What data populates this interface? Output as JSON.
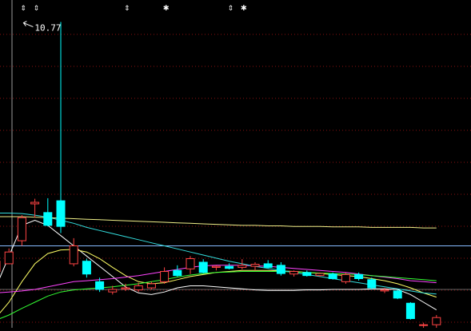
{
  "chart_data": {
    "type": "candlestick",
    "title": "",
    "xlabel": "",
    "ylabel": "",
    "ylim": [
      4.8,
      11.2
    ],
    "grid": true,
    "annotations": [
      {
        "text": "10.77",
        "at_candle": 2,
        "value": 10.77
      }
    ],
    "event_markers": [
      {
        "symbol": "⇕",
        "candle": 2
      },
      {
        "symbol": "⇕",
        "candle": 3
      },
      {
        "symbol": "⇕",
        "candle": 10
      },
      {
        "symbol": "✱",
        "candle": 13
      },
      {
        "symbol": "⇕",
        "candle": 18
      },
      {
        "symbol": "✱",
        "candle": 19
      }
    ],
    "candles": [
      {
        "o": 5.9,
        "h": 6.15,
        "l": 5.8,
        "c": 6.1,
        "dir": "up"
      },
      {
        "o": 6.28,
        "h": 6.35,
        "l": 6.05,
        "c": 6.05,
        "dir": "up"
      },
      {
        "o": 6.5,
        "h": 7.0,
        "l": 6.4,
        "c": 6.95,
        "dir": "up"
      },
      {
        "o": 7.22,
        "h": 7.32,
        "l": 6.95,
        "c": 7.25,
        "dir": "up"
      },
      {
        "o": 7.05,
        "h": 7.33,
        "l": 6.78,
        "c": 6.8,
        "dir": "down"
      },
      {
        "o": 7.28,
        "h": 10.77,
        "l": 6.65,
        "c": 6.78,
        "dir": "down"
      },
      {
        "o": 6.4,
        "h": 6.55,
        "l": 6.0,
        "c": 6.05,
        "dir": "up"
      },
      {
        "o": 6.1,
        "h": 6.15,
        "l": 5.78,
        "c": 5.85,
        "dir": "down"
      },
      {
        "o": 5.7,
        "h": 5.78,
        "l": 5.5,
        "c": 5.55,
        "dir": "down"
      },
      {
        "o": 5.55,
        "h": 5.62,
        "l": 5.45,
        "c": 5.5,
        "dir": "up"
      },
      {
        "o": 5.56,
        "h": 5.66,
        "l": 5.52,
        "c": 5.58,
        "dir": "up"
      },
      {
        "o": 5.54,
        "h": 5.68,
        "l": 5.5,
        "c": 5.62,
        "dir": "up"
      },
      {
        "o": 5.58,
        "h": 5.7,
        "l": 5.55,
        "c": 5.66,
        "dir": "up"
      },
      {
        "o": 5.7,
        "h": 5.98,
        "l": 5.66,
        "c": 5.9,
        "dir": "up"
      },
      {
        "o": 5.92,
        "h": 6.02,
        "l": 5.8,
        "c": 5.82,
        "dir": "down"
      },
      {
        "o": 5.95,
        "h": 6.2,
        "l": 5.85,
        "c": 6.15,
        "dir": "up"
      },
      {
        "o": 6.08,
        "h": 6.14,
        "l": 5.86,
        "c": 5.88,
        "dir": "down"
      },
      {
        "o": 5.98,
        "h": 6.02,
        "l": 5.92,
        "c": 6.0,
        "dir": "up"
      },
      {
        "o": 6.0,
        "h": 6.06,
        "l": 5.94,
        "c": 5.96,
        "dir": "down"
      },
      {
        "o": 5.98,
        "h": 6.14,
        "l": 5.94,
        "c": 6.02,
        "dir": "up"
      },
      {
        "o": 6.0,
        "h": 6.08,
        "l": 5.92,
        "c": 6.04,
        "dir": "up"
      },
      {
        "o": 6.05,
        "h": 6.12,
        "l": 5.96,
        "c": 5.98,
        "dir": "down"
      },
      {
        "o": 6.02,
        "h": 6.08,
        "l": 5.82,
        "c": 5.86,
        "dir": "down"
      },
      {
        "o": 5.85,
        "h": 5.92,
        "l": 5.8,
        "c": 5.9,
        "dir": "up"
      },
      {
        "o": 5.88,
        "h": 5.92,
        "l": 5.8,
        "c": 5.82,
        "dir": "down"
      },
      {
        "o": 5.82,
        "h": 5.88,
        "l": 5.8,
        "c": 5.86,
        "dir": "up"
      },
      {
        "o": 5.85,
        "h": 5.88,
        "l": 5.74,
        "c": 5.76,
        "dir": "down"
      },
      {
        "o": 5.7,
        "h": 5.88,
        "l": 5.66,
        "c": 5.84,
        "dir": "up"
      },
      {
        "o": 5.84,
        "h": 5.88,
        "l": 5.72,
        "c": 5.76,
        "dir": "down"
      },
      {
        "o": 5.74,
        "h": 5.78,
        "l": 5.55,
        "c": 5.58,
        "dir": "down"
      },
      {
        "o": 5.54,
        "h": 5.58,
        "l": 5.48,
        "c": 5.52,
        "dir": "up"
      },
      {
        "o": 5.52,
        "h": 5.54,
        "l": 5.36,
        "c": 5.38,
        "dir": "down"
      },
      {
        "o": 5.28,
        "h": 5.3,
        "l": 4.96,
        "c": 4.98,
        "dir": "down"
      },
      {
        "o": 4.86,
        "h": 4.9,
        "l": 4.8,
        "c": 4.86,
        "dir": "up"
      },
      {
        "o": 4.86,
        "h": 5.05,
        "l": 4.8,
        "c": 5.0,
        "dir": "up"
      }
    ],
    "series": [
      {
        "label_visible": false,
        "color": "#ffffff",
        "values": [
          5.6,
          6.2,
          6.8,
          6.9,
          6.8,
          6.6,
          6.4,
          6.2,
          6.0,
          5.8,
          5.6,
          5.48,
          5.45,
          5.5,
          5.58,
          5.62,
          5.62,
          5.6,
          5.58,
          5.56,
          5.54,
          5.53,
          5.53,
          5.53,
          5.54,
          5.54,
          5.55,
          5.55,
          5.55,
          5.56,
          5.56,
          5.55,
          5.45,
          5.3,
          5.15
        ]
      },
      {
        "label_visible": false,
        "color": "#ffff66",
        "values": [
          5.0,
          5.3,
          5.7,
          6.05,
          6.25,
          6.32,
          6.33,
          6.28,
          6.15,
          5.98,
          5.82,
          5.7,
          5.66,
          5.68,
          5.74,
          5.8,
          5.84,
          5.88,
          5.9,
          5.92,
          5.92,
          5.92,
          5.91,
          5.9,
          5.88,
          5.86,
          5.84,
          5.82,
          5.8,
          5.76,
          5.72,
          5.66,
          5.58,
          5.48,
          5.4
        ]
      },
      {
        "label_visible": false,
        "color": "#ff44ff",
        "values": [
          5.48,
          5.5,
          5.52,
          5.55,
          5.6,
          5.65,
          5.7,
          5.72,
          5.74,
          5.76,
          5.79,
          5.82,
          5.86,
          5.9,
          5.94,
          5.98,
          6.01,
          6.02,
          6.02,
          6.02,
          6.01,
          6.0,
          5.98,
          5.96,
          5.94,
          5.92,
          5.9,
          5.88,
          5.85,
          5.82,
          5.79,
          5.76,
          5.72,
          5.7,
          5.68
        ]
      },
      {
        "label_visible": false,
        "color": "#33ff33",
        "values": [
          4.95,
          5.05,
          5.18,
          5.3,
          5.42,
          5.5,
          5.54,
          5.56,
          5.58,
          5.6,
          5.63,
          5.66,
          5.7,
          5.74,
          5.79,
          5.83,
          5.86,
          5.88,
          5.89,
          5.9,
          5.9,
          5.9,
          5.9,
          5.89,
          5.88,
          5.87,
          5.86,
          5.85,
          5.84,
          5.82,
          5.8,
          5.78,
          5.76,
          5.74,
          5.72
        ]
      },
      {
        "label_visible": false,
        "color": "#33dddd",
        "values": [
          7.04,
          7.04,
          7.03,
          7.0,
          6.96,
          6.9,
          6.84,
          6.76,
          6.7,
          6.64,
          6.58,
          6.52,
          6.46,
          6.4,
          6.34,
          6.28,
          6.22,
          6.16,
          6.1,
          6.05,
          6.0,
          5.96,
          5.92,
          5.88,
          5.84,
          5.8,
          5.76,
          5.72,
          5.68,
          5.64,
          5.6,
          5.56,
          5.52,
          5.48,
          5.46
        ]
      },
      {
        "label_visible": false,
        "color": "#eeee88",
        "values": [
          6.97,
          6.97,
          6.97,
          6.96,
          6.95,
          6.94,
          6.93,
          6.92,
          6.91,
          6.9,
          6.89,
          6.88,
          6.87,
          6.86,
          6.85,
          6.84,
          6.83,
          6.82,
          6.81,
          6.8,
          6.8,
          6.79,
          6.79,
          6.78,
          6.78,
          6.78,
          6.77,
          6.77,
          6.77,
          6.76,
          6.76,
          6.76,
          6.76,
          6.75,
          6.75
        ]
      }
    ],
    "reference_lines": [
      {
        "value": 6.4,
        "color": "#88bbff"
      },
      {
        "value": 5.55,
        "color": "#666666"
      }
    ],
    "colors": {
      "up": "#ff4444",
      "down": "#00ffff",
      "grid": "#8a1010",
      "background": "#000000"
    }
  }
}
